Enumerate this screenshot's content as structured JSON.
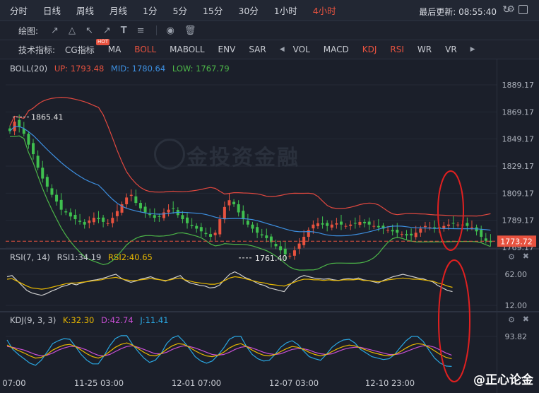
{
  "timeframes": [
    "分时",
    "日线",
    "周线",
    "月线",
    "1分",
    "5分",
    "15分",
    "30分",
    "1小时",
    "4小时"
  ],
  "active_timeframe": "4小时",
  "update_label": "最后更新: 08:55:40",
  "draw_label": "绘图:",
  "indicator_label": "技术指标:",
  "indicators_left": [
    "CG指标",
    "MA",
    "BOLL",
    "MABOLL",
    "ENV",
    "SAR"
  ],
  "indicators_right": [
    "VOL",
    "MACD",
    "KDJ",
    "RSI",
    "WR",
    "VR"
  ],
  "hot_badge": "HOT",
  "boll": {
    "title": "BOLL(20)",
    "up": "UP: 1793.48",
    "mid": "MID: 1780.64",
    "low": "LOW: 1767.79"
  },
  "rsi": {
    "title": "RSI(7, 14)",
    "rsi1": "RSI1:34.19",
    "rsi2": "RSI2:40.65"
  },
  "kdj": {
    "title": "KDJ(9, 3, 3)",
    "k": "K:32.30",
    "d": "D:42.74",
    "j": "J:11.41"
  },
  "colors": {
    "up": "#e7523f",
    "down": "#3fbf4f",
    "upper": "#e0483f",
    "mid": "#3d8fe0",
    "lower": "#4cb548",
    "rsi1": "#d0d0d0",
    "rsi2": "#e8b800",
    "kdj_k": "#e8b800",
    "kdj_d": "#c84fd4",
    "kdj_j": "#2aa6e0"
  },
  "watermark": "金投资金融",
  "brand": "@正心论金",
  "chart_data": {
    "type": "candlestick",
    "price_axis": [
      "1889.17",
      "1869.17",
      "1849.17",
      "1829.17",
      "1809.17",
      "1789.17",
      "1769.17"
    ],
    "current_price": "1773.72",
    "high_label": "1865.41",
    "low_label": "1761.40",
    "rsi_axis": [
      "62.00",
      "12.00"
    ],
    "kdj_axis": [
      "93.82"
    ],
    "x_labels": [
      "07:00",
      "11-25 03:00",
      "12-01 07:00",
      "12-07 03:00",
      "12-10 23:00"
    ],
    "close_series": [
      1855,
      1862,
      1858,
      1853,
      1845,
      1838,
      1828,
      1820,
      1814,
      1808,
      1803,
      1797,
      1795,
      1792,
      1790,
      1788,
      1786,
      1789,
      1791,
      1790,
      1788,
      1787,
      1791,
      1796,
      1801,
      1806,
      1808,
      1802,
      1798,
      1795,
      1793,
      1791,
      1792,
      1795,
      1797,
      1798,
      1793,
      1790,
      1787,
      1785,
      1783,
      1781,
      1779,
      1777,
      1780,
      1790,
      1799,
      1804,
      1801,
      1795,
      1790,
      1786,
      1783,
      1780,
      1778,
      1776,
      1773,
      1770,
      1767,
      1764,
      1763,
      1767,
      1772,
      1777,
      1782,
      1786,
      1787,
      1786,
      1785,
      1786,
      1787,
      1786,
      1785,
      1786,
      1787,
      1788,
      1787,
      1786,
      1785,
      1784,
      1783,
      1782,
      1781,
      1780,
      1779,
      1778,
      1778,
      1780,
      1783,
      1785,
      1784,
      1783,
      1784,
      1785,
      1786,
      1787,
      1786,
      1786,
      1785,
      1784,
      1781,
      1777,
      1774,
      1773
    ],
    "rsi1": [
      58,
      60,
      52,
      44,
      36,
      32,
      30,
      28,
      31,
      35,
      38,
      42,
      44,
      47,
      45,
      48,
      50,
      52,
      53,
      55,
      57,
      60,
      62,
      56,
      52,
      49,
      51,
      54,
      56,
      58,
      55,
      53,
      51,
      54,
      57,
      60,
      52,
      48,
      46,
      44,
      43,
      40,
      41,
      45,
      54,
      62,
      66,
      62,
      57,
      54,
      50,
      46,
      44,
      40,
      38,
      36,
      34,
      44,
      51,
      57,
      60,
      58,
      56,
      55,
      54,
      55,
      53,
      52,
      54,
      55,
      54,
      56,
      53,
      52,
      50,
      48,
      52,
      55,
      58,
      60,
      62,
      60,
      58,
      56,
      55,
      52,
      50,
      44,
      40,
      36,
      34
    ],
    "rsi2": [
      54,
      55,
      51,
      47,
      43,
      40,
      39,
      38,
      39,
      41,
      43,
      45,
      47,
      48,
      48,
      49,
      50,
      51,
      52,
      53,
      55,
      56,
      57,
      55,
      53,
      52,
      52,
      53,
      54,
      55,
      54,
      53,
      52,
      53,
      55,
      56,
      53,
      51,
      49,
      48,
      47,
      46,
      46,
      48,
      52,
      56,
      58,
      57,
      55,
      53,
      51,
      49,
      48,
      46,
      45,
      44,
      43,
      46,
      49,
      52,
      54,
      54,
      53,
      53,
      52,
      53,
      52,
      52,
      53,
      53,
      53,
      54,
      52,
      52,
      51,
      50,
      51,
      53,
      54,
      55,
      56,
      55,
      54,
      54,
      53,
      52,
      51,
      48,
      46,
      43,
      41
    ],
    "kdj_k": [
      70,
      62,
      55,
      48,
      40,
      34,
      36,
      44,
      56,
      64,
      70,
      72,
      66,
      56,
      46,
      38,
      34,
      40,
      52,
      64,
      72,
      76,
      70,
      60,
      50,
      42,
      40,
      46,
      58,
      68,
      74,
      72,
      64,
      54,
      46,
      40,
      38,
      42,
      50,
      62,
      70,
      74,
      66,
      56,
      48,
      42,
      40,
      44,
      52,
      60,
      66,
      64,
      58,
      50,
      44,
      40,
      44,
      52,
      60,
      66,
      70,
      68,
      62,
      56,
      50,
      46,
      42,
      40,
      44,
      52,
      62,
      70,
      74,
      72,
      64,
      54,
      44,
      36,
      32
    ],
    "kdj_d": [
      66,
      64,
      60,
      56,
      50,
      44,
      40,
      42,
      48,
      56,
      62,
      66,
      66,
      62,
      56,
      48,
      42,
      40,
      44,
      52,
      60,
      66,
      68,
      64,
      58,
      52,
      46,
      46,
      50,
      58,
      64,
      68,
      66,
      62,
      56,
      50,
      44,
      42,
      44,
      50,
      58,
      64,
      66,
      62,
      56,
      50,
      46,
      44,
      46,
      52,
      58,
      60,
      60,
      56,
      50,
      46,
      44,
      46,
      52,
      58,
      62,
      64,
      64,
      60,
      56,
      52,
      48,
      44,
      44,
      46,
      52,
      58,
      64,
      68,
      68,
      64,
      56,
      48,
      42
    ],
    "kdj_j": [
      84,
      58,
      44,
      32,
      20,
      14,
      28,
      50,
      74,
      82,
      88,
      86,
      66,
      44,
      28,
      18,
      18,
      40,
      68,
      88,
      96,
      96,
      72,
      52,
      34,
      22,
      28,
      46,
      74,
      90,
      96,
      80,
      60,
      38,
      26,
      20,
      26,
      42,
      62,
      86,
      94,
      94,
      66,
      44,
      32,
      26,
      28,
      44,
      64,
      76,
      82,
      72,
      54,
      38,
      32,
      28,
      44,
      64,
      76,
      84,
      86,
      76,
      58,
      48,
      38,
      34,
      30,
      32,
      44,
      64,
      82,
      94,
      94,
      80,
      56,
      34,
      20,
      12,
      11
    ]
  }
}
